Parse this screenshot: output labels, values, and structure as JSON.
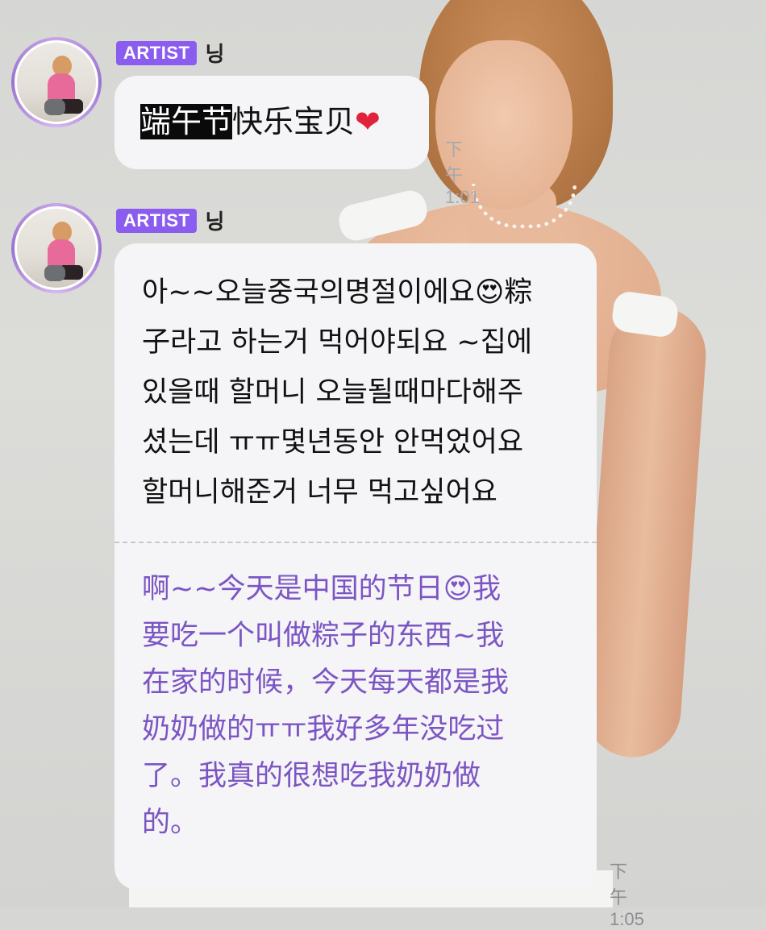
{
  "messages": [
    {
      "badge": "ARTIST",
      "sender": "닝",
      "text_highlight": "端午节",
      "text_rest": "快乐宝贝",
      "heart": "❤",
      "time": "下午1:01"
    },
    {
      "badge": "ARTIST",
      "sender": "닝",
      "original_lines": "아~~오늘중국의명절이에요😍粽\n子라고 하는거 먹어야되요 ~집에\n있을때 할머니 오늘될때마다해주\n셨는데 ㅠㅠ몇년동안 안먹었어요\n할머니해준거 너무 먹고싶어요",
      "translation_lines": "啊~~今天是中国的节日😍我\n要吃一个叫做粽子的东西~我\n在家的时候，今天每天都是我\n奶奶做的ㅠㅠ我好多年没吃过\n了。我真的很想吃我奶奶做\n的。",
      "time": "下午1:05"
    }
  ],
  "colors": {
    "badge_bg": "#8b5cf0",
    "translation_text": "#7b55c4",
    "bubble_bg": "#f5f4f6",
    "timestamp": "#8e8c90"
  },
  "icons": [
    "avatar-photo",
    "heart-icon",
    "heart-eyes-emoji"
  ]
}
